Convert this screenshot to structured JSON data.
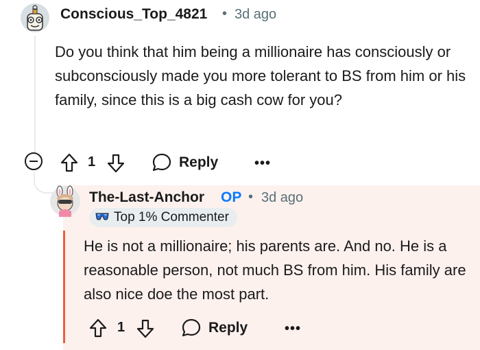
{
  "comment": {
    "author": "Conscious_Top_4821",
    "separator": "•",
    "time": "3d ago",
    "body": "Do you think that him being a millionaire has consciously or subconsciously made you more tolerant to BS from him or his family, since this is a big cash cow for you?",
    "votes": "1",
    "reply_label": "Reply",
    "more_label": "•••",
    "icons": [
      "avatar",
      "collapse-icon",
      "upvote-icon",
      "downvote-icon",
      "reply-icon",
      "more-icon"
    ]
  },
  "reply": {
    "author": "The-Last-Anchor",
    "op_tag": "OP",
    "separator": "•",
    "time": "3d ago",
    "flair": "Top 1% Commenter",
    "body": "He is not a millionaire; his parents are. And no. He is a reasonable person, not much BS from him. His family are also nice doe the most part.",
    "votes": "1",
    "reply_label": "Reply",
    "more_label": "•••",
    "highlight_color": "#fdf1ee",
    "accent_color": "#e8603c",
    "op_color": "#0a7aff"
  }
}
